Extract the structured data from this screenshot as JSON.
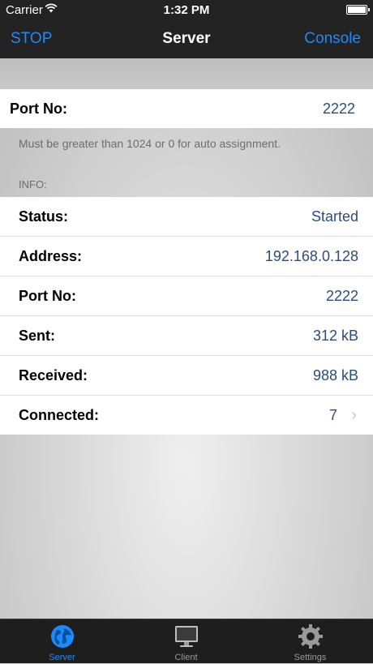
{
  "status_bar": {
    "carrier": "Carrier",
    "time": "1:32 PM"
  },
  "navbar": {
    "left_button": "STOP",
    "title": "Server",
    "right_button": "Console"
  },
  "port_setting": {
    "label": "Port No:",
    "value": "2222"
  },
  "hint": "Must be greater than 1024 or 0 for auto assignment.",
  "info_header": "INFO:",
  "info_rows": [
    {
      "label": "Status:",
      "value": "Started"
    },
    {
      "label": "Address:",
      "value": "192.168.0.128"
    },
    {
      "label": "Port No:",
      "value": "2222"
    },
    {
      "label": "Sent:",
      "value": "312 kB"
    },
    {
      "label": "Received:",
      "value": "988 kB"
    },
    {
      "label": "Connected:",
      "value": "7"
    }
  ],
  "tabs": [
    {
      "label": "Server",
      "icon": "globe-icon",
      "active": true
    },
    {
      "label": "Client",
      "icon": "monitor-icon",
      "active": false
    },
    {
      "label": "Settings",
      "icon": "gear-icon",
      "active": false
    }
  ],
  "colors": {
    "accent": "#1a8cff",
    "value_text": "#2b4c7e",
    "bar_bg": "#232323"
  }
}
